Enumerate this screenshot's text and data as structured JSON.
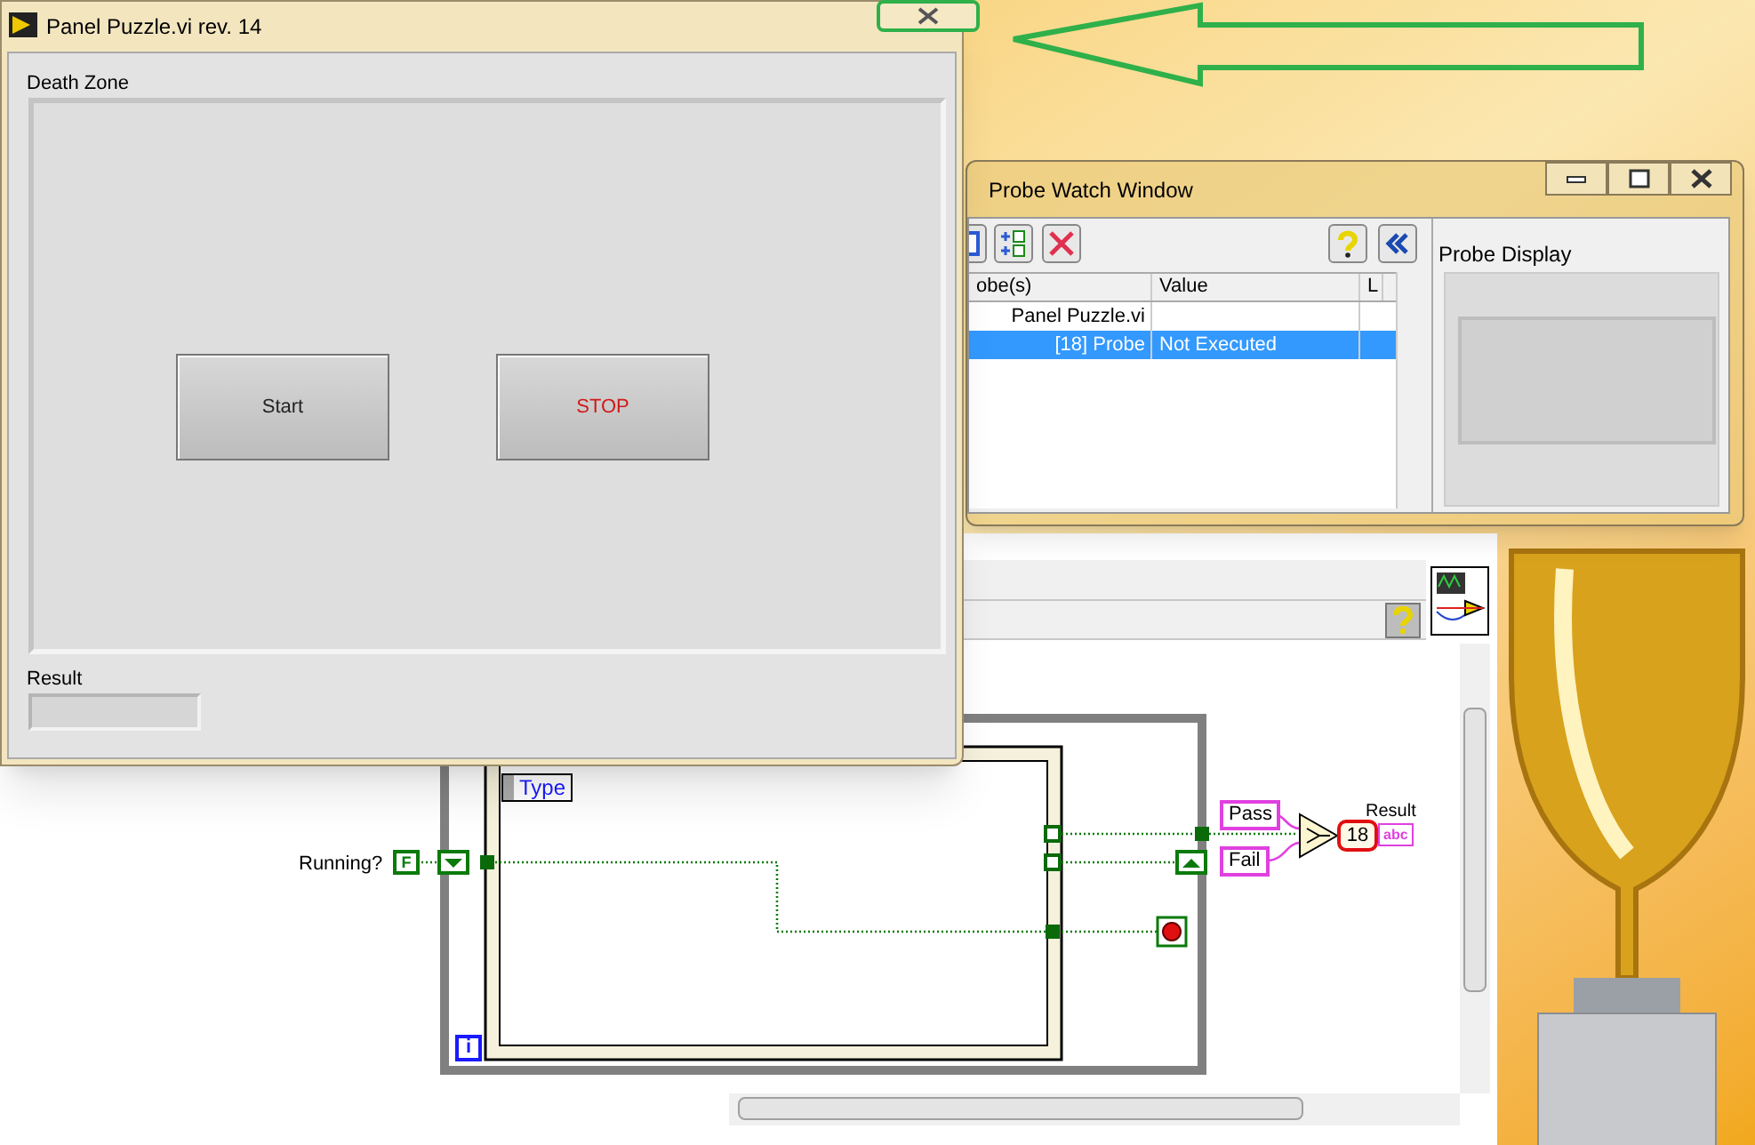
{
  "front_panel": {
    "title": "Panel Puzzle.vi rev. 14",
    "section_label": "Death Zone",
    "buttons": [
      {
        "label": "Start",
        "kind": "plain"
      },
      {
        "label": "STOP",
        "kind": "stop"
      }
    ],
    "result_label": "Result"
  },
  "probe_window": {
    "title": "Probe Watch Window",
    "columns": [
      "obe(s)",
      "Value",
      "L"
    ],
    "rows": [
      {
        "probe": "Panel Puzzle.vi",
        "value": "",
        "selected": false
      },
      {
        "probe": "[18] Probe",
        "value": "Not Executed",
        "selected": true
      }
    ],
    "display_title": "Probe Display"
  },
  "diagram": {
    "running_label": "Running?",
    "bool_constant": "F",
    "case_selector": "Type",
    "constants": [
      "Pass",
      "Fail"
    ],
    "probe_number": "18",
    "indicator_label": "Result",
    "indicator_type": "abc",
    "iteration": "i"
  }
}
